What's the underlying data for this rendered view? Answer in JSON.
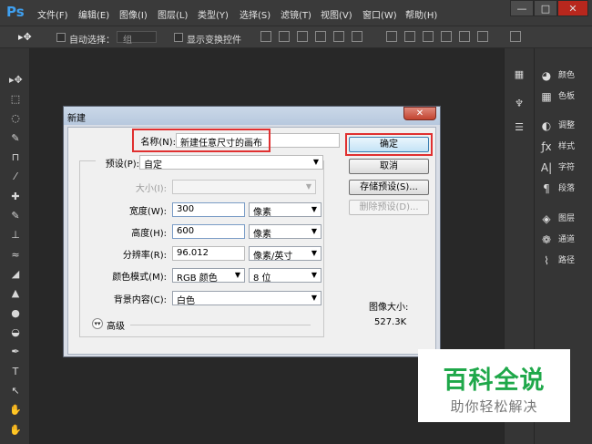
{
  "app": {
    "logo": "Ps"
  },
  "menu": [
    "文件(F)",
    "编辑(E)",
    "图像(I)",
    "图层(L)",
    "类型(Y)",
    "选择(S)",
    "滤镜(T)",
    "视图(V)",
    "窗口(W)",
    "帮助(H)"
  ],
  "window_buttons": {
    "minimize": "—",
    "maximize": "□",
    "close": "✕"
  },
  "options_bar": {
    "move_icon": "▸✥",
    "auto_select_label": "自动选择：",
    "auto_select_value": "组",
    "show_transform_label": "显示变换控件"
  },
  "tools": [
    "▸✥",
    "⬚",
    "◌",
    "✎",
    "⊓",
    "⁄",
    "✚",
    "✎",
    "⊥",
    "≈",
    "◢",
    "▲",
    "●",
    "◒",
    "✒",
    "T",
    "↖",
    "✋",
    "✋"
  ],
  "right_panel": {
    "items": [
      {
        "icon": "palette-icon",
        "label": "颜色"
      },
      {
        "icon": "swatches-icon",
        "label": "色板"
      },
      {
        "icon": "adjust-icon",
        "label": "调整"
      },
      {
        "icon": "styles-icon",
        "label": "样式"
      },
      {
        "icon": "character-icon",
        "label": "字符"
      },
      {
        "icon": "paragraph-icon",
        "label": "段落"
      },
      {
        "icon": "layers-icon",
        "label": "图层"
      },
      {
        "icon": "channels-icon",
        "label": "通道"
      },
      {
        "icon": "paths-icon",
        "label": "路径"
      }
    ]
  },
  "dialog": {
    "title": "新建",
    "close": "✕",
    "name_label": "名称(N):",
    "name_value": "新建任意尺寸的画布",
    "preset_label": "预设(P):",
    "preset_value": "自定",
    "size_label": "大小(I):",
    "width_label": "宽度(W):",
    "width_value": "300",
    "width_unit": "像素",
    "height_label": "高度(H):",
    "height_value": "600",
    "height_unit": "像素",
    "resolution_label": "分辨率(R):",
    "resolution_value": "96.012",
    "resolution_unit": "像素/英寸",
    "color_mode_label": "颜色模式(M):",
    "color_mode_value": "RGB 颜色",
    "bit_depth_value": "8 位",
    "background_label": "背景内容(C):",
    "background_value": "白色",
    "advanced_label": "高级",
    "ok_button": "确定",
    "cancel_button": "取消",
    "save_preset_button": "存储预设(S)...",
    "delete_preset_button": "删除预设(D)...",
    "image_size_label": "图像大小:",
    "image_size_value": "527.3K"
  },
  "watermark": {
    "title": "百科全说",
    "subtitle": "助你轻松解决"
  },
  "colors": {
    "ok_highlight": "#e03030",
    "watermark_green": "#1fa84a"
  }
}
